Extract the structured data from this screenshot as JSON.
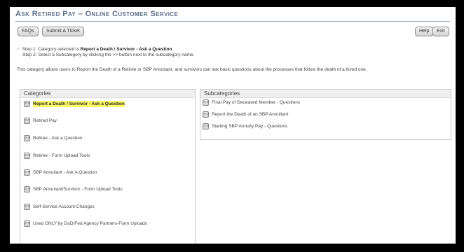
{
  "app": {
    "title": "Ask Retired Pay – Online Customer Service"
  },
  "toolbar": {
    "faqs": "FAQs",
    "submit_ticket": "Submit A Ticket",
    "help": "Help",
    "exit": "Exit"
  },
  "steps": {
    "step1_prefix": "Step 1: Category selected is",
    "step1_value": "Report a Death / Survivor - Ask a Question",
    "step2": "Step 2: Select a Subcategory by clicking the >> button next to the subcategory name."
  },
  "description": "This category allows users to Report the Death of a Retiree or SBP Annuitant, and survivors can ask basic questions about the processes that follow the death of a loved one.",
  "categories": {
    "header": "Categories",
    "button_glyph": ">>",
    "items": [
      {
        "label": "Report a Death / Survivor - Ask a Question"
      },
      {
        "label": "Retired Pay"
      },
      {
        "label": "Retiree - Ask a Question"
      },
      {
        "label": "Retiree - Form Upload Tools"
      },
      {
        "label": "SBP Annuitant - Ask A Question"
      },
      {
        "label": "SBP Annuitant/Survivor - Form Upload Tools"
      },
      {
        "label": "Self-Service Account Changes"
      },
      {
        "label": "Used ONLY by DoD/Fed Agency Partners-Form Uploads"
      }
    ]
  },
  "subcategories": {
    "header": "Subcategories",
    "items": [
      {
        "label": "Final Pay of Deceased Member - Questions"
      },
      {
        "label": "Report the Death of an SBP Annuitant"
      },
      {
        "label": "Starting SBP Annuity Pay - Questions"
      }
    ]
  }
}
